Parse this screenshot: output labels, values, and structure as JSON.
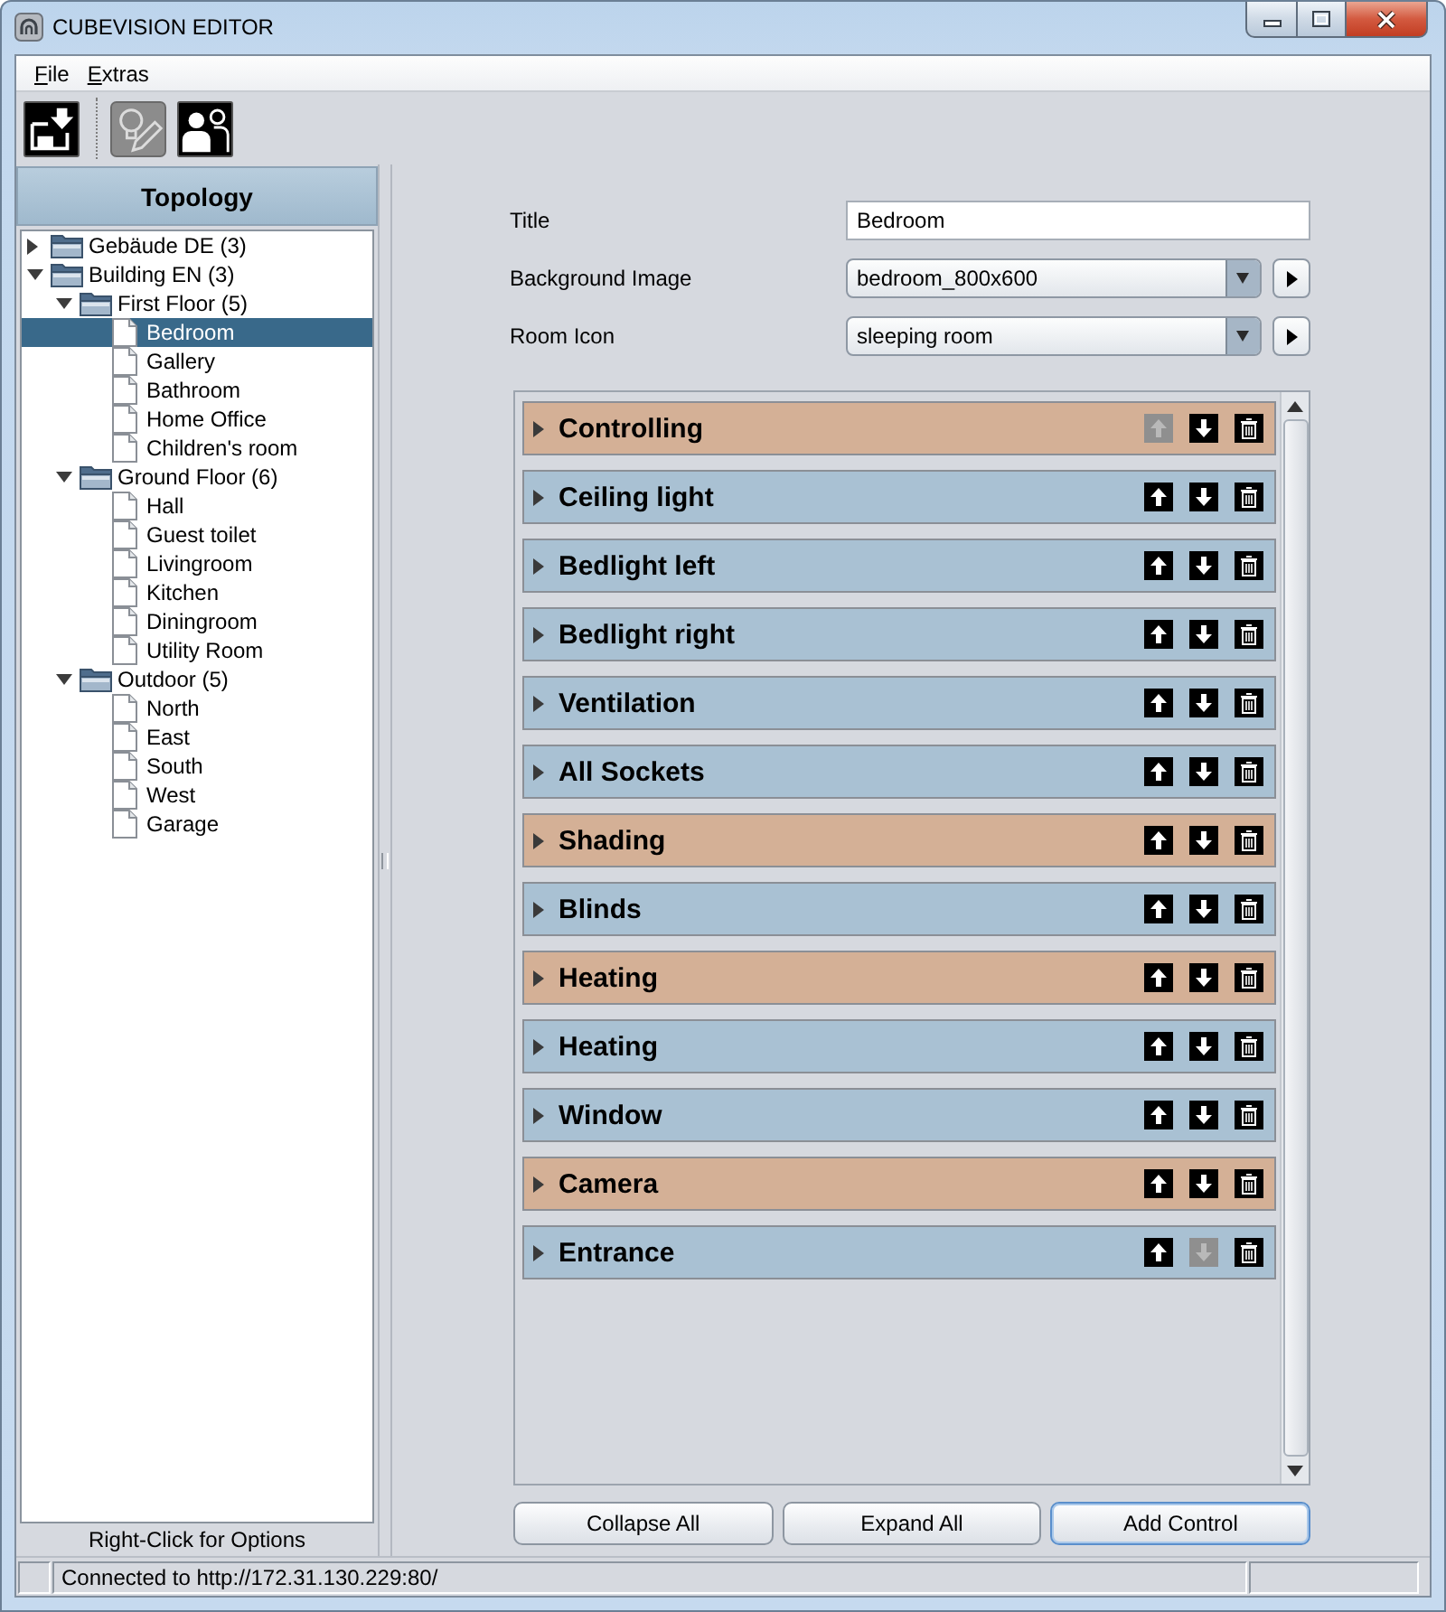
{
  "window": {
    "title": "CUBEVISION EDITOR"
  },
  "menu": [
    "File",
    "Extras"
  ],
  "toolbar": [
    {
      "kind": "tray",
      "selected": false
    },
    {
      "kind": "edit",
      "selected": true
    },
    {
      "kind": "people",
      "selected": false
    }
  ],
  "topology": {
    "title": "Topology",
    "tree": [
      {
        "kind": "folder",
        "label": "Gebäude DE (3)",
        "expanded": false,
        "selected": false
      },
      {
        "kind": "folder",
        "label": "Building EN (3)",
        "expanded": true,
        "selected": false,
        "children": [
          {
            "kind": "folder",
            "label": "First Floor (5)",
            "expanded": true,
            "selected": false,
            "children": [
              {
                "kind": "room",
                "label": "Bedroom",
                "selected": true
              },
              {
                "kind": "room",
                "label": "Gallery",
                "selected": false
              },
              {
                "kind": "room",
                "label": "Bathroom",
                "selected": false
              },
              {
                "kind": "room",
                "label": "Home Office",
                "selected": false
              },
              {
                "kind": "room",
                "label": "Children's room",
                "selected": false
              }
            ]
          },
          {
            "kind": "folder",
            "label": "Ground Floor (6)",
            "expanded": true,
            "selected": false,
            "children": [
              {
                "kind": "room",
                "label": "Hall",
                "selected": false
              },
              {
                "kind": "room",
                "label": "Guest toilet",
                "selected": false
              },
              {
                "kind": "room",
                "label": "Livingroom",
                "selected": false
              },
              {
                "kind": "room",
                "label": "Kitchen",
                "selected": false
              },
              {
                "kind": "room",
                "label": "Diningroom",
                "selected": false
              },
              {
                "kind": "room",
                "label": "Utility Room",
                "selected": false
              }
            ]
          },
          {
            "kind": "folder",
            "label": "Outdoor (5)",
            "expanded": true,
            "selected": false,
            "children": [
              {
                "kind": "room",
                "label": "North",
                "selected": false
              },
              {
                "kind": "room",
                "label": "East",
                "selected": false
              },
              {
                "kind": "room",
                "label": "South",
                "selected": false
              },
              {
                "kind": "room",
                "label": "West",
                "selected": false
              },
              {
                "kind": "room",
                "label": "Garage",
                "selected": false
              }
            ]
          }
        ]
      }
    ],
    "hint": "Right-Click for Options"
  },
  "form": [
    {
      "kind": "text",
      "label": "Title",
      "value": "Bedroom"
    },
    {
      "kind": "dropdown",
      "label": "Background Image",
      "value": "bedroom_800x600"
    },
    {
      "kind": "dropdown",
      "label": "Room Icon",
      "value": "sleeping room"
    }
  ],
  "controls": [
    {
      "name": "Controlling",
      "color": "#d4b096",
      "up_disabled": true,
      "down_disabled": false
    },
    {
      "name": "Ceiling light",
      "color": "#a9c1d3",
      "up_disabled": false,
      "down_disabled": false
    },
    {
      "name": "Bedlight left",
      "color": "#a9c1d3",
      "up_disabled": false,
      "down_disabled": false
    },
    {
      "name": "Bedlight right",
      "color": "#a9c1d3",
      "up_disabled": false,
      "down_disabled": false
    },
    {
      "name": "Ventilation",
      "color": "#a9c1d3",
      "up_disabled": false,
      "down_disabled": false
    },
    {
      "name": "All Sockets",
      "color": "#a9c1d3",
      "up_disabled": false,
      "down_disabled": false
    },
    {
      "name": "Shading",
      "color": "#d4b096",
      "up_disabled": false,
      "down_disabled": false
    },
    {
      "name": "Blinds",
      "color": "#a9c1d3",
      "up_disabled": false,
      "down_disabled": false
    },
    {
      "name": "Heating",
      "color": "#d4b096",
      "up_disabled": false,
      "down_disabled": false
    },
    {
      "name": "Heating",
      "color": "#a9c1d3",
      "up_disabled": false,
      "down_disabled": false
    },
    {
      "name": "Window",
      "color": "#a9c1d3",
      "up_disabled": false,
      "down_disabled": false
    },
    {
      "name": "Camera",
      "color": "#d4b096",
      "up_disabled": false,
      "down_disabled": false
    },
    {
      "name": "Entrance",
      "color": "#a9c1d3",
      "up_disabled": false,
      "down_disabled": true
    }
  ],
  "buttons": [
    {
      "label": "Collapse All",
      "focused": false
    },
    {
      "label": "Expand All",
      "focused": false
    },
    {
      "label": "Add Control",
      "focused": true
    }
  ],
  "status_bar": {
    "text": "Connected to http://172.31.130.229:80/"
  }
}
